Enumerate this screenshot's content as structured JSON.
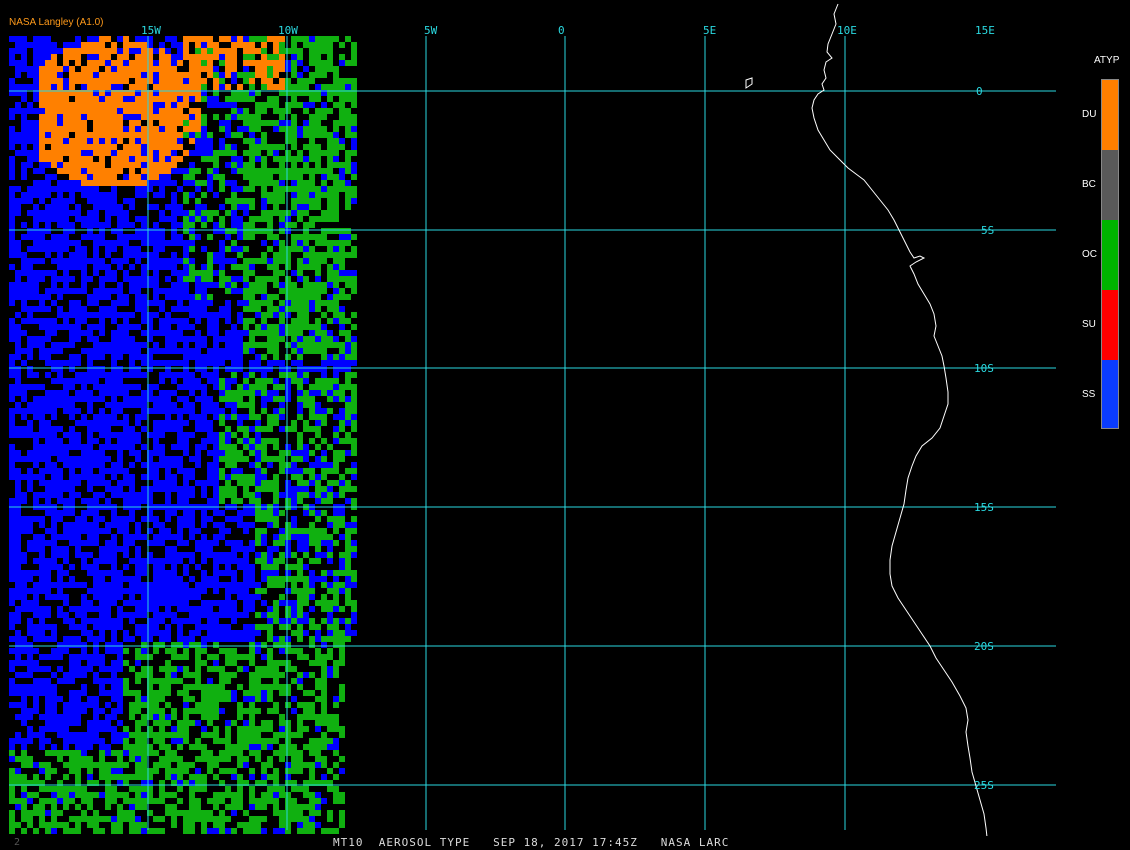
{
  "credit": "NASA Langley (A1.0)",
  "product_line": "MT10  AEROSOL TYPE   SEP 18, 2017 17:45Z   NASA LARC",
  "corner_mark": "2",
  "lon_labels": [
    "15W",
    "10W",
    "5W",
    "0",
    "5E",
    "10E",
    "15E"
  ],
  "lat_labels": [
    "0",
    "5S",
    "10S",
    "15S",
    "20S",
    "25S"
  ],
  "legend": {
    "title": "ATYP",
    "items": [
      {
        "code": "DU",
        "color": "#ff7f00"
      },
      {
        "code": "BC",
        "color": "#595959"
      },
      {
        "code": "OC",
        "color": "#00b400"
      },
      {
        "code": "SU",
        "color": "#ff0000"
      },
      {
        "code": "SS",
        "color": "#0a3cff"
      }
    ]
  },
  "colors": {
    "grid": "#2ad9e0",
    "coast": "#ffffff",
    "sea_salt": "#0000ff",
    "organic": "#10b010",
    "dust": "#ff8000"
  }
}
